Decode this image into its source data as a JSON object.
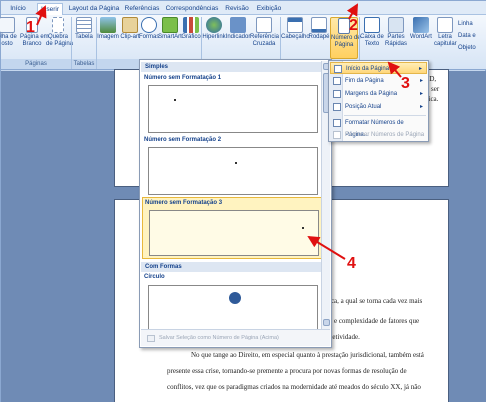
{
  "tabs": [
    "Início",
    "Inserir",
    "Layout da Página",
    "Referências",
    "Correspondências",
    "Revisão",
    "Exibição"
  ],
  "ribbon": {
    "buttons": {
      "folha_rosto": "olha de\nosto",
      "pagina_branco": "Página em\nBranco",
      "quebra": "Quebra\nde Página",
      "tabela": "Tabela",
      "imagem": "Imagem",
      "clipart": "Clip-art",
      "formas": "Formas",
      "smartart": "SmartArt",
      "grafico": "Gráfico",
      "hiperlink": "Hiperlink",
      "indicador": "Indicador",
      "ref_cruzada": "Referência\nCruzada",
      "cabecalho": "Cabeçalho",
      "rodape": "Rodapé",
      "numero_pagina": "Número de\nPágina",
      "caixa_texto": "Caixa de\nTexto",
      "partes_rapidas": "Partes\nRápidas",
      "wordart": "WordArt",
      "letra_capitular": "Letra\ncapitular",
      "linha_assinatura": "Linha",
      "data_hora": "Data e",
      "objeto": "Objeto"
    },
    "groups": {
      "paginas": "Páginas",
      "tabelas": "Tabelas",
      "ilustracoes": "Ilu"
    }
  },
  "menu": {
    "items": [
      {
        "label": "Início da Página",
        "has_submenu": true,
        "highlighted": true
      },
      {
        "label": "Fim da Página",
        "has_submenu": true
      },
      {
        "label": "Margens da Página",
        "has_submenu": true
      },
      {
        "label": "Posição Atual",
        "has_submenu": true
      },
      {
        "label": "Formatar Números de Página..."
      },
      {
        "label": "Remover Números de Página",
        "disabled": true
      }
    ]
  },
  "gallery": {
    "section_simples": "Simples",
    "section_formas": "Com Formas",
    "item1": "Número sem Formatação 1",
    "item2": "Número sem Formatação 2",
    "item3": "Número sem Formatação 3",
    "item_circulo": "Círculo",
    "footer": "Salvar Seleção como Número de Página (Acima)"
  },
  "document": {
    "right_fragments": [
      "ID,",
      "ser",
      "dica."
    ],
    "lines": [
      "gmática, a qual se torna cada vez mais",
      "dade e complexidade de fatores que",
      "a coletividade.",
      "No que tange ao Direito, em especial quanto à prestação jurisdicional, também está",
      "presente essa crise, tornando-se premente a procura por novas formas de resolução de",
      "conflitos, vez que os paradigmas criados na modernidade até meados do século XX, já não"
    ]
  },
  "annotations": [
    "1",
    "2",
    "3",
    "4"
  ],
  "colors": {
    "accent": "#e01010",
    "highlight": "#ffd060",
    "ribbon": "#d6e4f5"
  }
}
